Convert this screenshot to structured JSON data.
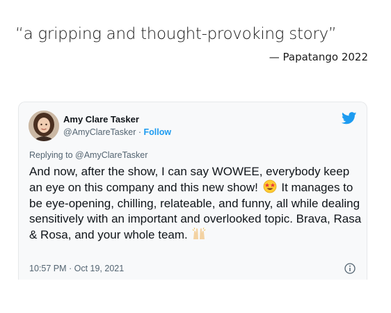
{
  "quote": {
    "text": "“a gripping and thought-provoking story”",
    "attribution": "— Papatango 2022"
  },
  "tweet": {
    "author_name": "Amy Clare Tasker",
    "author_handle": "@AmyClareTasker",
    "separator": "·",
    "follow_label": "Follow",
    "replying_prefix": "Replying to",
    "replying_handle": "@AmyClareTasker",
    "text_part1": "And now, after the show, I can say WOWEE, everybody keep an eye on this company and this new show!",
    "text_part2": "It manages to be eye-opening, chilling, relateable, and funny, all while dealing sensitively with an important and overlooked topic. Brava, Rasa & Rosa, and your whole team.",
    "timestamp": "10:57 PM · Oct 19, 2021",
    "emoji_1": "star-struck-emoji",
    "emoji_2": "raising-hands-emoji"
  },
  "colors": {
    "accent": "#1d9bf0",
    "muted": "#536471",
    "card_bg": "#f8f9fa"
  }
}
